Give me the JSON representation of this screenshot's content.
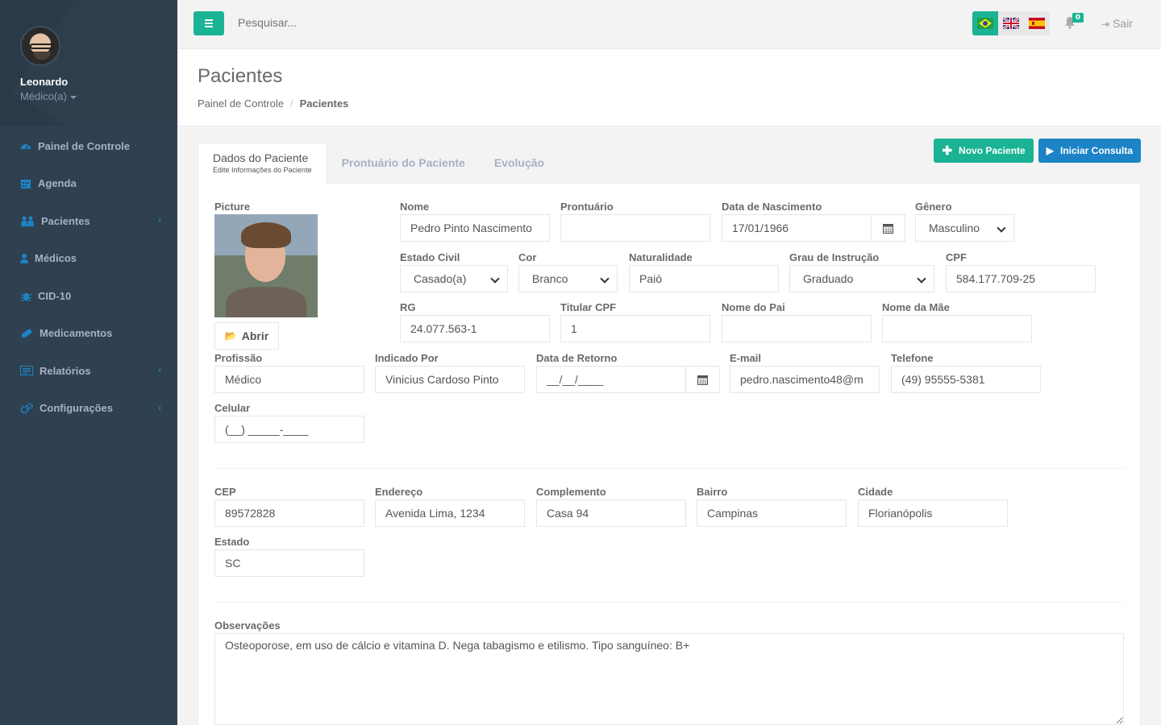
{
  "user": {
    "name": "Leonardo",
    "role": "Médico(a)"
  },
  "sidebar": {
    "items": [
      {
        "label": "Painel de Controle",
        "icon": "dashboard-icon"
      },
      {
        "label": "Agenda",
        "icon": "calendar-icon"
      },
      {
        "label": "Pacientes",
        "icon": "users-icon"
      },
      {
        "label": "Médicos",
        "icon": "user-icon"
      },
      {
        "label": "CID-10",
        "icon": "bug-icon"
      },
      {
        "label": "Medicamentos",
        "icon": "pill-icon"
      },
      {
        "label": "Relatórios",
        "icon": "report-icon"
      },
      {
        "label": "Configurações",
        "icon": "cogs-icon"
      }
    ]
  },
  "topbar": {
    "search_placeholder": "Pesquisar...",
    "notifications": "0",
    "logout": "Sair"
  },
  "page": {
    "title": "Pacientes",
    "breadcrumb": [
      "Painel de Controle",
      "Pacientes"
    ]
  },
  "tabs": [
    {
      "label": "Dados do Paciente",
      "sub": "Edite Informações do Paciente"
    },
    {
      "label": "Prontuário do Paciente"
    },
    {
      "label": "Evolução"
    }
  ],
  "buttons": {
    "new_patient": "Novo Paciente",
    "start_consult": "Iniciar Consulta",
    "open": "Abrir"
  },
  "form": {
    "picture_label": "Picture",
    "nome": {
      "label": "Nome",
      "value": "Pedro Pinto Nascimento"
    },
    "prontuario": {
      "label": "Prontuário",
      "value": ""
    },
    "nascimento": {
      "label": "Data de Nascimento",
      "value": "17/01/1966"
    },
    "genero": {
      "label": "Gênero",
      "value": "Masculino"
    },
    "estado_civil": {
      "label": "Estado Civil",
      "value": "Casado(a)"
    },
    "cor": {
      "label": "Cor",
      "value": "Branco"
    },
    "naturalidade": {
      "label": "Naturalidade",
      "value": "Paió"
    },
    "instrucao": {
      "label": "Grau de Instrução",
      "value": "Graduado"
    },
    "cpf": {
      "label": "CPF",
      "value": "584.177.709-25"
    },
    "rg": {
      "label": "RG",
      "value": "24.077.563-1"
    },
    "titular_cpf": {
      "label": "Titular CPF",
      "value": "1"
    },
    "nome_pai": {
      "label": "Nome do Pai",
      "value": ""
    },
    "nome_mae": {
      "label": "Nome da Mãe",
      "value": ""
    },
    "profissao": {
      "label": "Profissão",
      "value": "Médico"
    },
    "indicado": {
      "label": "Indicado Por",
      "value": "Vinicius Cardoso Pinto"
    },
    "retorno": {
      "label": "Data de Retorno",
      "value": "__/__/____"
    },
    "email": {
      "label": "E-mail",
      "value": "pedro.nascimento48@m"
    },
    "telefone": {
      "label": "Telefone",
      "value": "(49) 95555-5381"
    },
    "celular": {
      "label": "Celular",
      "value": "(__) _____-____"
    },
    "cep": {
      "label": "CEP",
      "value": "89572828"
    },
    "endereco": {
      "label": "Endereço",
      "value": "Avenida Lima, 1234"
    },
    "complemento": {
      "label": "Complemento",
      "value": "Casa 94"
    },
    "bairro": {
      "label": "Bairro",
      "value": "Campinas"
    },
    "cidade": {
      "label": "Cidade",
      "value": "Florianópolis"
    },
    "estado": {
      "label": "Estado",
      "value": "SC"
    },
    "observacoes": {
      "label": "Observações",
      "value": "Osteoporose, em uso de cálcio e vitamina D. Nega tabagismo e etilismo. Tipo sanguíneo: B+"
    }
  },
  "colors": {
    "sidebar": "#2f4050",
    "primary": "#1ab394",
    "info": "#1c84c6"
  }
}
